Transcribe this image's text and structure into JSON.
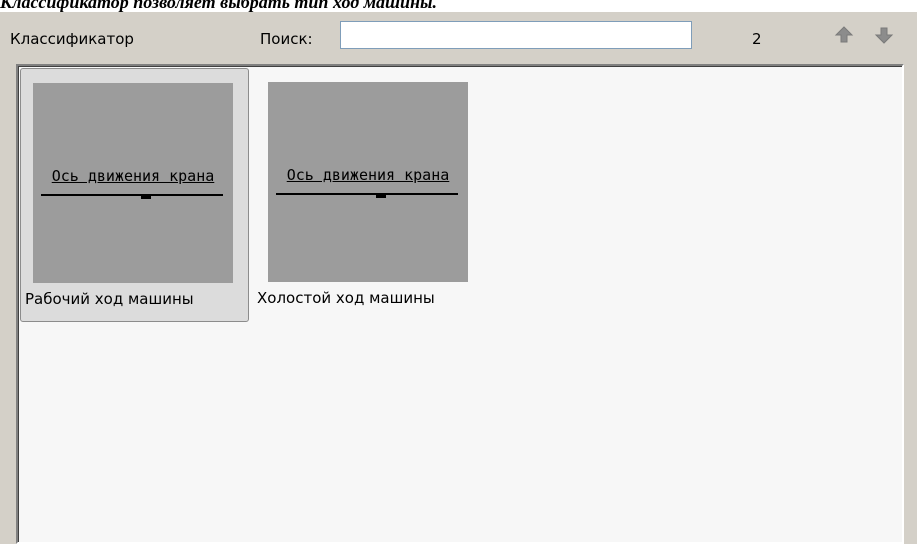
{
  "caption": "Классификатор позволяет выбрать тип ход машины.",
  "toolbar": {
    "title": "Классификатор",
    "search_label": "Поиск:",
    "search_value": "",
    "count": "2",
    "up_icon": "arrow-up-icon",
    "down_icon": "arrow-down-icon"
  },
  "items": [
    {
      "label": "Рабочий ход машины",
      "thumb_text": "Ось движения крана",
      "selected": true
    },
    {
      "label": "Холостой ход машины",
      "thumb_text": "Ось движения крана",
      "selected": false
    }
  ],
  "colors": {
    "panel_bg": "#d4d0c8",
    "content_bg": "#f7f7f7",
    "thumb_bg": "#9c9c9c",
    "selected_bg": "#dcdcdc"
  }
}
